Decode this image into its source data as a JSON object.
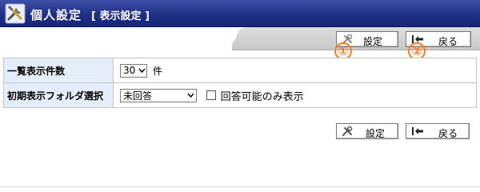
{
  "header": {
    "title": "個人設定",
    "subtitle": "[ 表示設定 ]",
    "icon": "tools-icon"
  },
  "toolbar": {
    "set_label": "設定",
    "back_label": "戻る",
    "set_icon": "tools-icon",
    "back_icon": "back-arrow-icon"
  },
  "markers": {
    "one": "①",
    "two": "②"
  },
  "form": {
    "rows": [
      {
        "label": "一覧表示件数",
        "select_value": "30",
        "suffix": "件"
      },
      {
        "label": "初期表示フォルダ選択",
        "select_value": "未回答",
        "checkbox_label": "回答可能のみ表示",
        "checkbox_checked": false
      }
    ]
  },
  "colors": {
    "header_bg": "#1f2f86",
    "label_bg": "#e4eefb",
    "marker": "#ff7a1a"
  }
}
